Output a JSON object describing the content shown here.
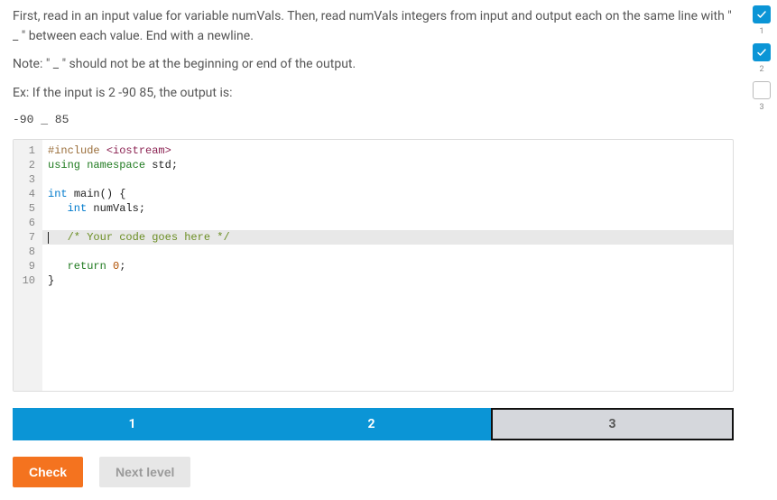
{
  "instructions": {
    "p1": "First, read in an input value for variable numVals. Then, read numVals integers from input and output each on the same line with \" _ \" between each value. End with a newline.",
    "p2": "Note: \" _ \" should not be at the beginning or end of the output.",
    "p3": "Ex: If the input is 2 -90 85, the output is:",
    "example_out": "-90 _ 85"
  },
  "code": {
    "lines": [
      {
        "n": 1,
        "tokens": [
          [
            "pp",
            "#include"
          ],
          [
            "punc",
            " "
          ],
          [
            "str",
            "<iostream>"
          ]
        ]
      },
      {
        "n": 2,
        "tokens": [
          [
            "kw",
            "using"
          ],
          [
            "punc",
            " "
          ],
          [
            "kw",
            "namespace"
          ],
          [
            "punc",
            " "
          ],
          [
            "id",
            "std"
          ],
          [
            "punc",
            ";"
          ]
        ]
      },
      {
        "n": 3,
        "tokens": []
      },
      {
        "n": 4,
        "tokens": [
          [
            "type",
            "int"
          ],
          [
            "punc",
            " "
          ],
          [
            "id",
            "main"
          ],
          [
            "punc",
            "() {"
          ]
        ]
      },
      {
        "n": 5,
        "tokens": [
          [
            "punc",
            "   "
          ],
          [
            "type",
            "int"
          ],
          [
            "punc",
            " "
          ],
          [
            "id",
            "numVals"
          ],
          [
            "punc",
            ";"
          ]
        ]
      },
      {
        "n": 6,
        "tokens": []
      },
      {
        "n": 7,
        "hl": true,
        "cursor": true,
        "tokens": [
          [
            "punc",
            "   "
          ],
          [
            "com",
            "/* Your code goes here */"
          ]
        ]
      },
      {
        "n": 8,
        "tokens": []
      },
      {
        "n": 9,
        "tokens": [
          [
            "punc",
            "   "
          ],
          [
            "kw",
            "return"
          ],
          [
            "punc",
            " "
          ],
          [
            "num",
            "0"
          ],
          [
            "punc",
            ";"
          ]
        ]
      },
      {
        "n": 10,
        "tokens": [
          [
            "punc",
            "}"
          ]
        ]
      }
    ]
  },
  "levels": {
    "items": [
      {
        "label": "1",
        "state": "done"
      },
      {
        "label": "2",
        "state": "done"
      },
      {
        "label": "3",
        "state": "current"
      }
    ]
  },
  "actions": {
    "check": "Check",
    "next": "Next level"
  },
  "side": {
    "items": [
      {
        "label": "1",
        "checked": true
      },
      {
        "label": "2",
        "checked": true
      },
      {
        "label": "3",
        "checked": false
      }
    ]
  }
}
